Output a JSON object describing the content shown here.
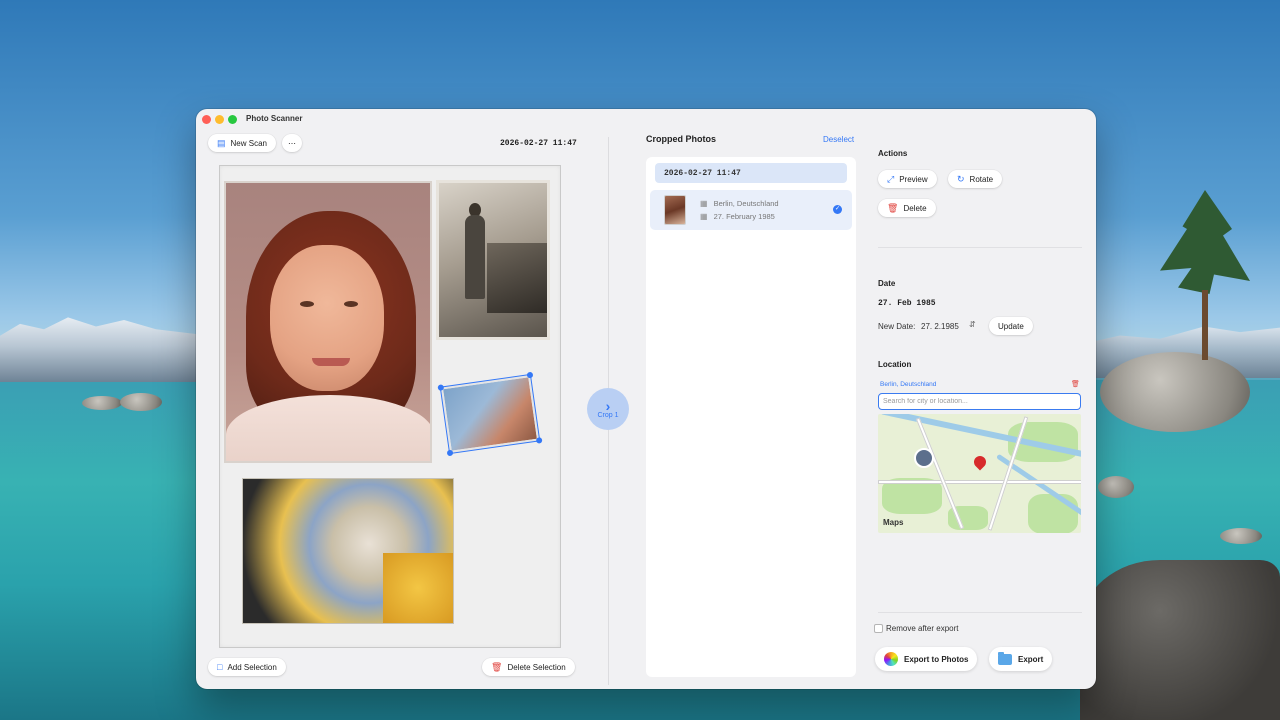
{
  "window": {
    "title": "Photo Scanner"
  },
  "toolbar": {
    "new_scan_label": "New Scan",
    "more_label": "⋯"
  },
  "scan": {
    "date": "2026-02-27 11:47",
    "add_selection_label": "Add Selection",
    "delete_selection_label": "Delete Selection",
    "crop_button_label": "Crop 1"
  },
  "cropped": {
    "title": "Cropped Photos",
    "deselect_label": "Deselect",
    "group_header": "2026-02-27 11:47",
    "items": [
      {
        "location": "Berlin, Deutschland",
        "date": "27. February 1985",
        "selected": true
      }
    ]
  },
  "actions": {
    "title": "Actions",
    "preview_label": "Preview",
    "rotate_label": "Rotate",
    "delete_label": "Delete"
  },
  "date_section": {
    "title": "Date",
    "current": "27. Feb 1985",
    "new_date_label": "New Date:",
    "new_date_value": "27. 2.1985",
    "update_label": "Update"
  },
  "location_section": {
    "title": "Location",
    "current": "Berlin, Deutschland",
    "search_placeholder": "Search for city or location...",
    "maps_label": "Maps"
  },
  "export": {
    "remove_after_label": "Remove after export",
    "export_photos_label": "Export to Photos",
    "export_label": "Export"
  },
  "colors": {
    "accent": "#3478f6",
    "danger": "#e0443e"
  }
}
